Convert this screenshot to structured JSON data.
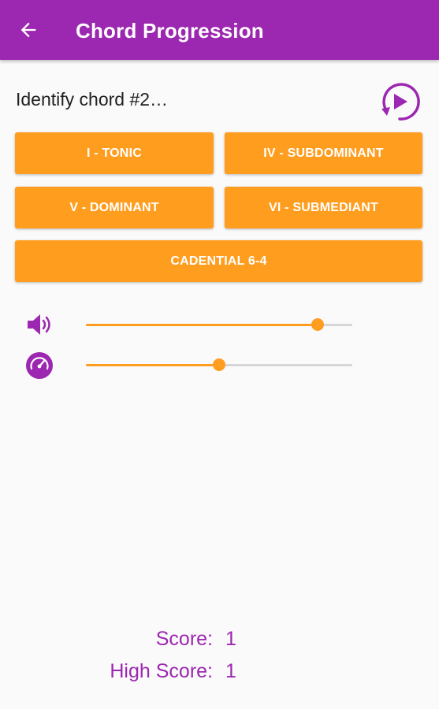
{
  "appbar": {
    "title": "Chord Progression",
    "color": "#9c27b0"
  },
  "prompt": "Identify chord #2…",
  "buttons": {
    "tonic": "I - TONIC",
    "subdominant": "IV - SUBDOMINANT",
    "dominant": "V - DOMINANT",
    "submediant": "VI - SUBMEDIANT",
    "cadential": "CADENTIAL 6-4",
    "color": "#ff9d1f"
  },
  "sliders": {
    "volume": {
      "icon": "volume-icon",
      "value": 0.87
    },
    "tempo": {
      "icon": "tempo-gauge-icon",
      "value": 0.5
    }
  },
  "score": {
    "score_label": "Score:",
    "score_value": "1",
    "high_score_label": "High Score:",
    "high_score_value": "1"
  }
}
